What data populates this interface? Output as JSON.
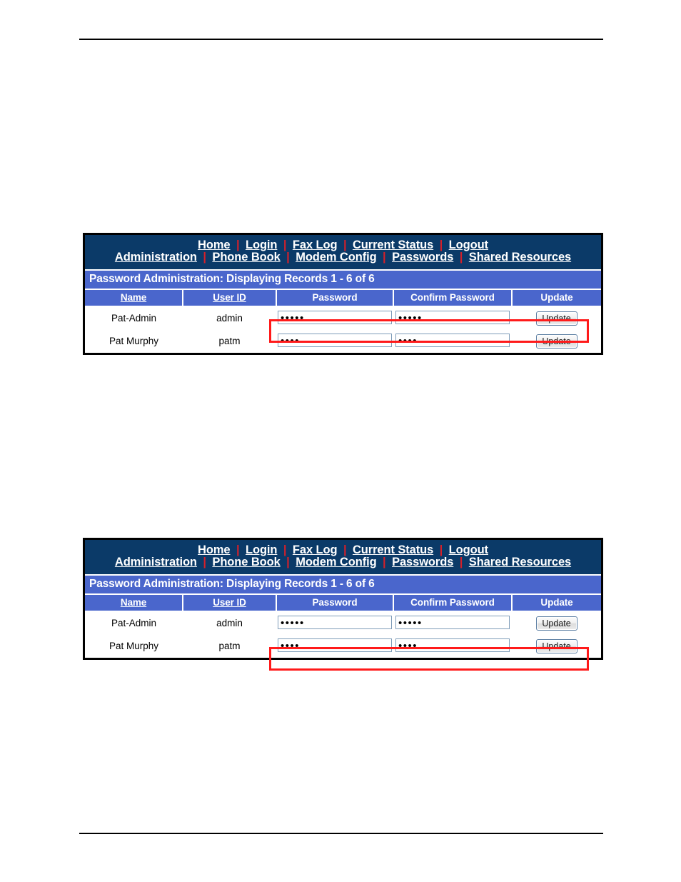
{
  "page": {
    "rules": [
      "top-rule",
      "bottom-rule"
    ]
  },
  "nav": {
    "row1": [
      {
        "label": "Home",
        "name": "nav-home"
      },
      {
        "label": "Login",
        "name": "nav-login"
      },
      {
        "label": "Fax Log",
        "name": "nav-fax-log"
      },
      {
        "label": "Current Status",
        "name": "nav-current-status"
      },
      {
        "label": "Logout",
        "name": "nav-logout"
      }
    ],
    "row2": [
      {
        "label": "Administration",
        "name": "nav-administration"
      },
      {
        "label": "Phone Book",
        "name": "nav-phone-book"
      },
      {
        "label": "Modem Config",
        "name": "nav-modem-config"
      },
      {
        "label": "Passwords",
        "name": "nav-passwords"
      },
      {
        "label": "Shared Resources",
        "name": "nav-shared-resources"
      }
    ],
    "separator": "|",
    "bg_color": "#0b3a68",
    "link_color": "#ffffff",
    "separator_color": "#d4202a"
  },
  "title_bar": {
    "text": "Password Administration: Displaying Records 1 - 6 of 6",
    "bg_color": "#4a66cc",
    "text_color": "#ffffff"
  },
  "table": {
    "headers": [
      {
        "label": "Name",
        "sortable": true
      },
      {
        "label": "User ID",
        "sortable": true
      },
      {
        "label": "Password",
        "sortable": false
      },
      {
        "label": "Confirm Password",
        "sortable": false
      },
      {
        "label": "Update",
        "sortable": false
      }
    ],
    "rows": [
      {
        "name": "Pat-Admin",
        "user_id": "admin",
        "password": "•••••",
        "confirm_password": "•••••",
        "update_label": "Update"
      },
      {
        "name": "Pat Murphy",
        "user_id": "patm",
        "password": "••••",
        "confirm_password": "••••",
        "update_label": "Update"
      }
    ]
  },
  "annotations": {
    "highlight_color": "#ff1a1a",
    "panel_1_highlighted_row": "Pat-Admin",
    "panel_2_highlighted_row": "Pat Murphy"
  }
}
